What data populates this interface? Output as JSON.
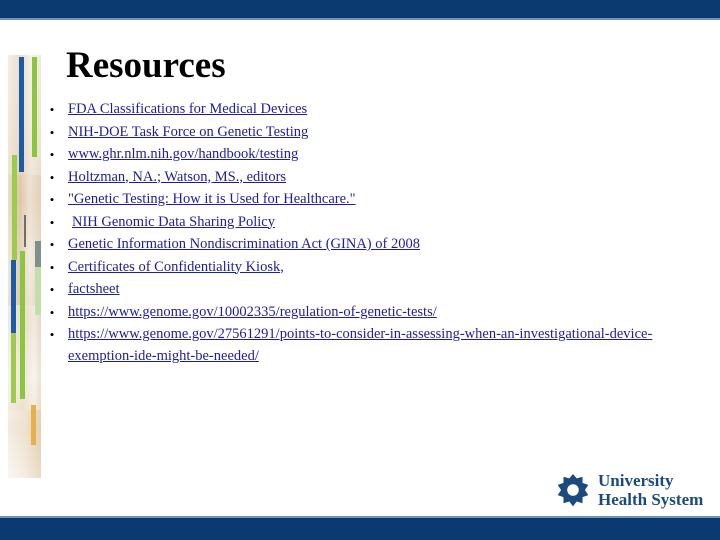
{
  "slide": {
    "title": "Resources",
    "bullet_marker": "•",
    "bullets": [
      {
        "text": "FDA Classifications for Medical Devices",
        "lead_space": false
      },
      {
        "text": "NIH-DOE Task Force on Genetic Testing",
        "lead_space": false
      },
      {
        "text": "www.ghr.nlm.nih.gov/handbook/testing",
        "lead_space": false
      },
      {
        "text": "Holtzman, NA.; Watson, MS., editors",
        "lead_space": false
      },
      {
        "text": "\"Genetic Testing: How it is Used for Healthcare.\"",
        "lead_space": false
      },
      {
        "text": "NIH Genomic Data Sharing Policy",
        "lead_space": true
      },
      {
        "text": "Genetic Information Nondiscrimination Act (GINA) of 2008",
        "lead_space": false
      },
      {
        "text": "Certificates of Confidentiality Kiosk,",
        "lead_space": false
      },
      {
        "text": "factsheet",
        "lead_space": false
      },
      {
        "text": "https://www.genome.gov/10002335/regulation-of-genetic-tests/",
        "lead_space": false
      },
      {
        "text": "https://www.genome.gov/27561291/points-to-consider-in-assessing-when-an-investigational-device-exemption-ide-might-be-needed/",
        "lead_space": false
      }
    ]
  },
  "logo": {
    "line1": "University",
    "line2": "Health System",
    "mark": "eight-point-star",
    "color": "#1b4a7e"
  },
  "theme": {
    "band_navy": "#0a3a70",
    "band_rule": "#6f93b5",
    "link_blue": "#1d1d9e",
    "title_black": "#000000",
    "deco_blue": "#1c5ba6",
    "deco_green": "#8cc63f",
    "deco_gold": "#e8b04b"
  }
}
